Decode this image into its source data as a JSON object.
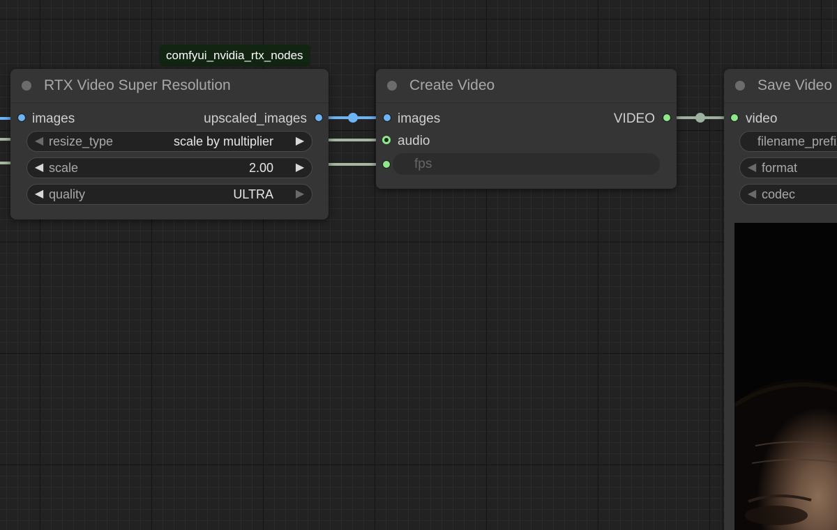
{
  "badge": {
    "text": "comfyui_nvidia_rtx_nodes"
  },
  "nodes": {
    "rtx_vsr": {
      "title": "RTX Video Super Resolution",
      "inputs": [
        "images"
      ],
      "outputs": [
        "upscaled_images"
      ],
      "widgets": [
        {
          "name": "resize_type",
          "value": "scale by multiplier"
        },
        {
          "name": "scale",
          "value": "2.00"
        },
        {
          "name": "quality",
          "value": "ULTRA"
        }
      ]
    },
    "create_video": {
      "title": "Create Video",
      "inputs": [
        "images",
        "audio"
      ],
      "outputs": [
        "VIDEO"
      ],
      "widget_input": {
        "placeholder": "fps"
      }
    },
    "save_video": {
      "title": "Save Video",
      "inputs": [
        "video"
      ],
      "widgets": [
        {
          "name": "filename_prefix"
        },
        {
          "name": "format"
        },
        {
          "name": "codec"
        }
      ]
    }
  },
  "colors": {
    "image_link": "#6cb4f5",
    "video_link": "#9eb0a0",
    "other_link": "#a7b7a3",
    "node_bg": "#353535",
    "canvas_bg": "#222222"
  },
  "icons": {
    "widget_decrement": "◀",
    "widget_increment": "▶"
  }
}
